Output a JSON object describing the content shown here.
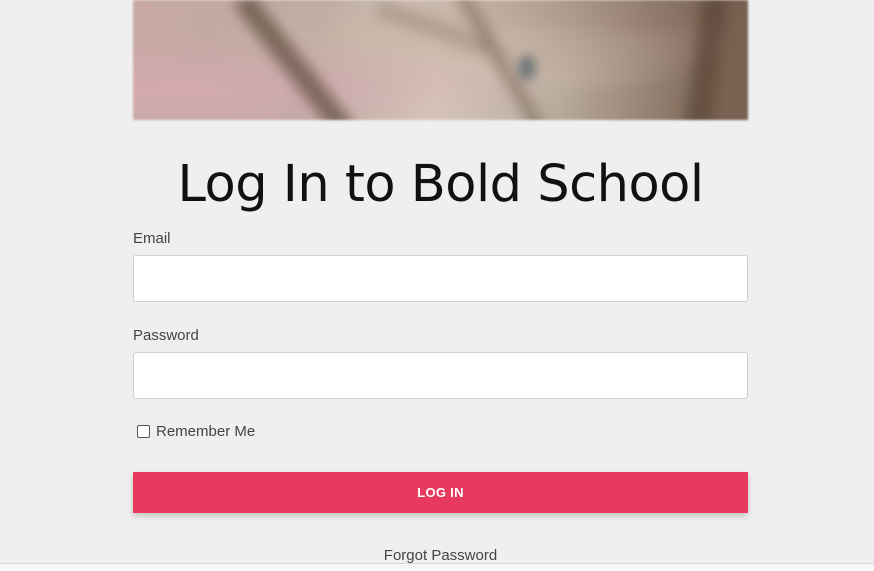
{
  "page": {
    "title": "Log In to Bold School"
  },
  "form": {
    "email_label": "Email",
    "email_value": "",
    "password_label": "Password",
    "password_value": "",
    "remember_label": "Remember Me",
    "remember_checked": false,
    "submit_label": "LOG IN",
    "forgot_label": "Forgot Password"
  },
  "colors": {
    "background": "#efefef",
    "accent": "#e83a5e"
  }
}
